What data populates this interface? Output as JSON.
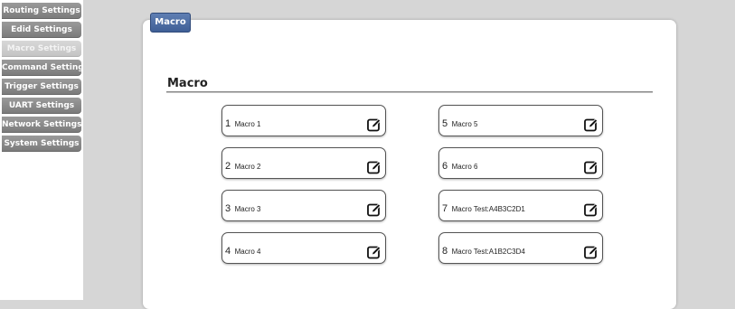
{
  "sidebar": {
    "items": [
      {
        "label": "Routing Settings",
        "active": false
      },
      {
        "label": "Edid Settings",
        "active": false
      },
      {
        "label": "Macro Settings",
        "active": true
      },
      {
        "label": "Command Settings",
        "active": false
      },
      {
        "label": "Trigger Settings",
        "active": false
      },
      {
        "label": "UART Settings",
        "active": false
      },
      {
        "label": "Network Settings",
        "active": false
      },
      {
        "label": "System Settings",
        "active": false
      }
    ]
  },
  "panel": {
    "tab_label": "Macro",
    "section_title": "Macro"
  },
  "macros": [
    {
      "number": "1",
      "name": "Macro 1"
    },
    {
      "number": "2",
      "name": "Macro 2"
    },
    {
      "number": "3",
      "name": "Macro 3"
    },
    {
      "number": "4",
      "name": "Macro 4"
    },
    {
      "number": "5",
      "name": "Macro 5"
    },
    {
      "number": "6",
      "name": "Macro 6"
    },
    {
      "number": "7",
      "name": "Macro Test:A4B3C2D1"
    },
    {
      "number": "8",
      "name": "Macro Test:A1B2C3D4"
    }
  ],
  "icons": {
    "edit": "edit-icon"
  },
  "colors": {
    "tab_blue": "#3f5f96",
    "nav_gray": "#8a8a8a",
    "nav_active": "#cfcfcf",
    "background": "#d6d6d6"
  }
}
